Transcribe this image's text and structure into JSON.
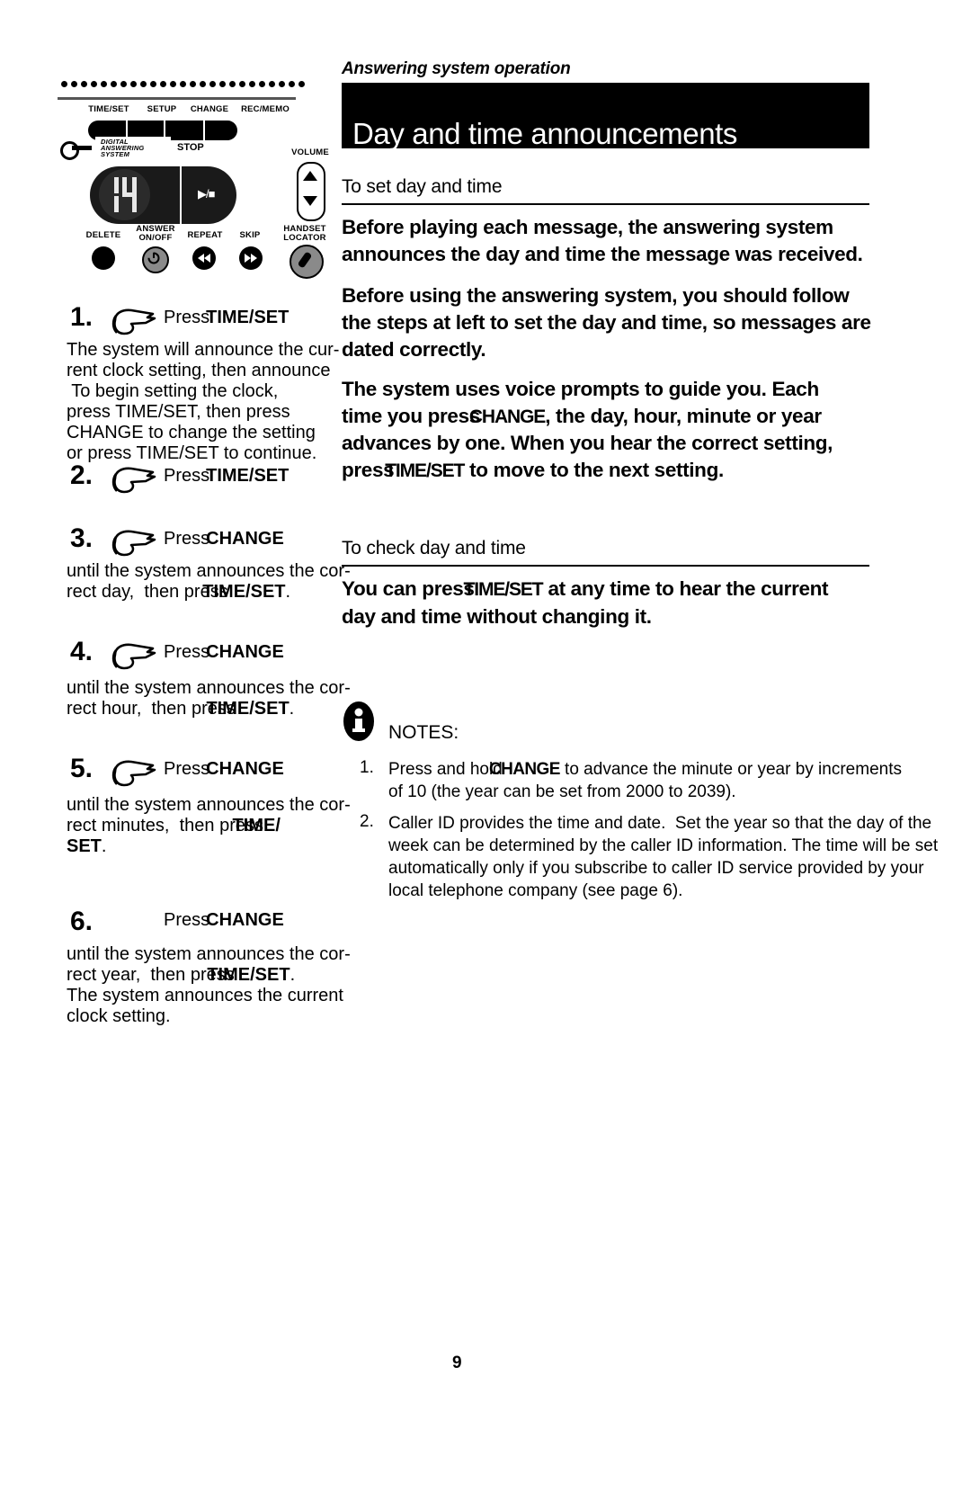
{
  "document": {
    "running_head": "Answering system operation",
    "banner_title": "Day and time announcements",
    "page_number": "9"
  },
  "device": {
    "top_keys": [
      "TIME/SET",
      "SETUP",
      "CHANGE",
      "REC/MEMO"
    ],
    "brand_lines": [
      "DIGITAL",
      "ANSWERING",
      "SYSTEM"
    ],
    "display_value": "14",
    "stop_label": "STOP",
    "play_stop_label": "▶/■",
    "volume_label": "VOLUME",
    "volume_up_icon": "triangle-up-icon",
    "volume_down_icon": "triangle-down-icon",
    "bottom_keys": [
      {
        "label": "DELETE",
        "icon": "blank-round-button-icon"
      },
      {
        "label": "ANSWER\nON/OFF",
        "icon": "power-icon"
      },
      {
        "label": "REPEAT",
        "icon": "rewind-icon"
      },
      {
        "label": "SKIP",
        "icon": "fast-forward-icon"
      },
      {
        "label": "HANDSET\nLOCATOR",
        "icon": "handset-icon"
      }
    ]
  },
  "left_column": {
    "steps": [
      {
        "number": "1.",
        "hand_icon": "pointing-hand-icon",
        "press_word": "Press",
        "press_key": "TIME/SET",
        "body": "The system will announce the cur-\nrent clock setting, then announce\n To begin setting the clock,\npress TIME/SET, then press\nCHANGE to change the setting\nor press TIME/SET to continue."
      },
      {
        "number": "2.",
        "hand_icon": "pointing-hand-icon",
        "press_word": "Press",
        "press_key": "TIME/SET",
        "body": ""
      },
      {
        "number": "3.",
        "hand_icon": "pointing-hand-icon",
        "press_word": "Press",
        "press_key": "CHANGE",
        "body_pre": "until the system announces the cor-\nrect day,  then press ",
        "body_key": "TIME/SET",
        "body_post": "."
      },
      {
        "number": "4.",
        "hand_icon": "pointing-hand-icon",
        "press_word": "Press",
        "press_key": "CHANGE",
        "body_pre": "until the system announces the cor-\nrect hour,  then press ",
        "body_key": "TIME/SET",
        "body_post": "."
      },
      {
        "number": "5.",
        "hand_icon": "pointing-hand-icon",
        "press_word": "Press",
        "press_key": "CHANGE",
        "body_pre": "until the system announces the cor-\nrect minutes,  then press ",
        "body_key": "TIME/\nSET",
        "body_post": "."
      },
      {
        "number": "6.",
        "hand_icon": "",
        "press_word": "Press",
        "press_key": "CHANGE",
        "body_pre": "until the system announces the cor-\nrect year,  then press ",
        "body_key": "TIME/SET",
        "body_post": ".\nThe system announces the current\nclock setting."
      }
    ]
  },
  "right_column": {
    "heading_set": "To set day and time",
    "paragraph_1": "Before playing each message, the answering system\nannounces the day and time the message was received.",
    "paragraph_2_a": "Before using the answering system, you should follow\nthe steps at left to set the day and time, so messages are\n",
    "paragraph_2_b": "dated correctly.",
    "paragraph_3_line1": "The system uses voice prompts to guide you. Each",
    "paragraph_3_line2_pre": "time you press ",
    "paragraph_3_line2_key": "CHANGE",
    "paragraph_3_line2_post": ", the day, hour, minute or year",
    "paragraph_3_line3": "advances by one. When you hear the correct setting,",
    "paragraph_3_line4_pre": "press ",
    "paragraph_3_line4_key": "TIME/SET",
    "paragraph_3_line4_post": " to move to the next setting.",
    "heading_check": "To check day and time",
    "check_pre": "You can press ",
    "check_key": "TIME/SET",
    "check_post": " at any time to hear the current\nday and time without changing it."
  },
  "notes": {
    "icon": "info-icon",
    "label": "NOTES:",
    "items": [
      {
        "number": "1.",
        "pre": "Press and hold ",
        "key": "CHANGE",
        "post": " to advance the minute or year by increments\nof 10 (the year can be set from 2000 to 2039)."
      },
      {
        "number": "2.",
        "pre": "",
        "key": "",
        "post": "Caller ID provides the time and date.  Set the year so that the day of the\nweek can be determined by the caller ID information. The time will be set\nautomatically only if you subscribe to caller ID service provided by your\nlocal telephone company (see page 6)."
      }
    ]
  }
}
